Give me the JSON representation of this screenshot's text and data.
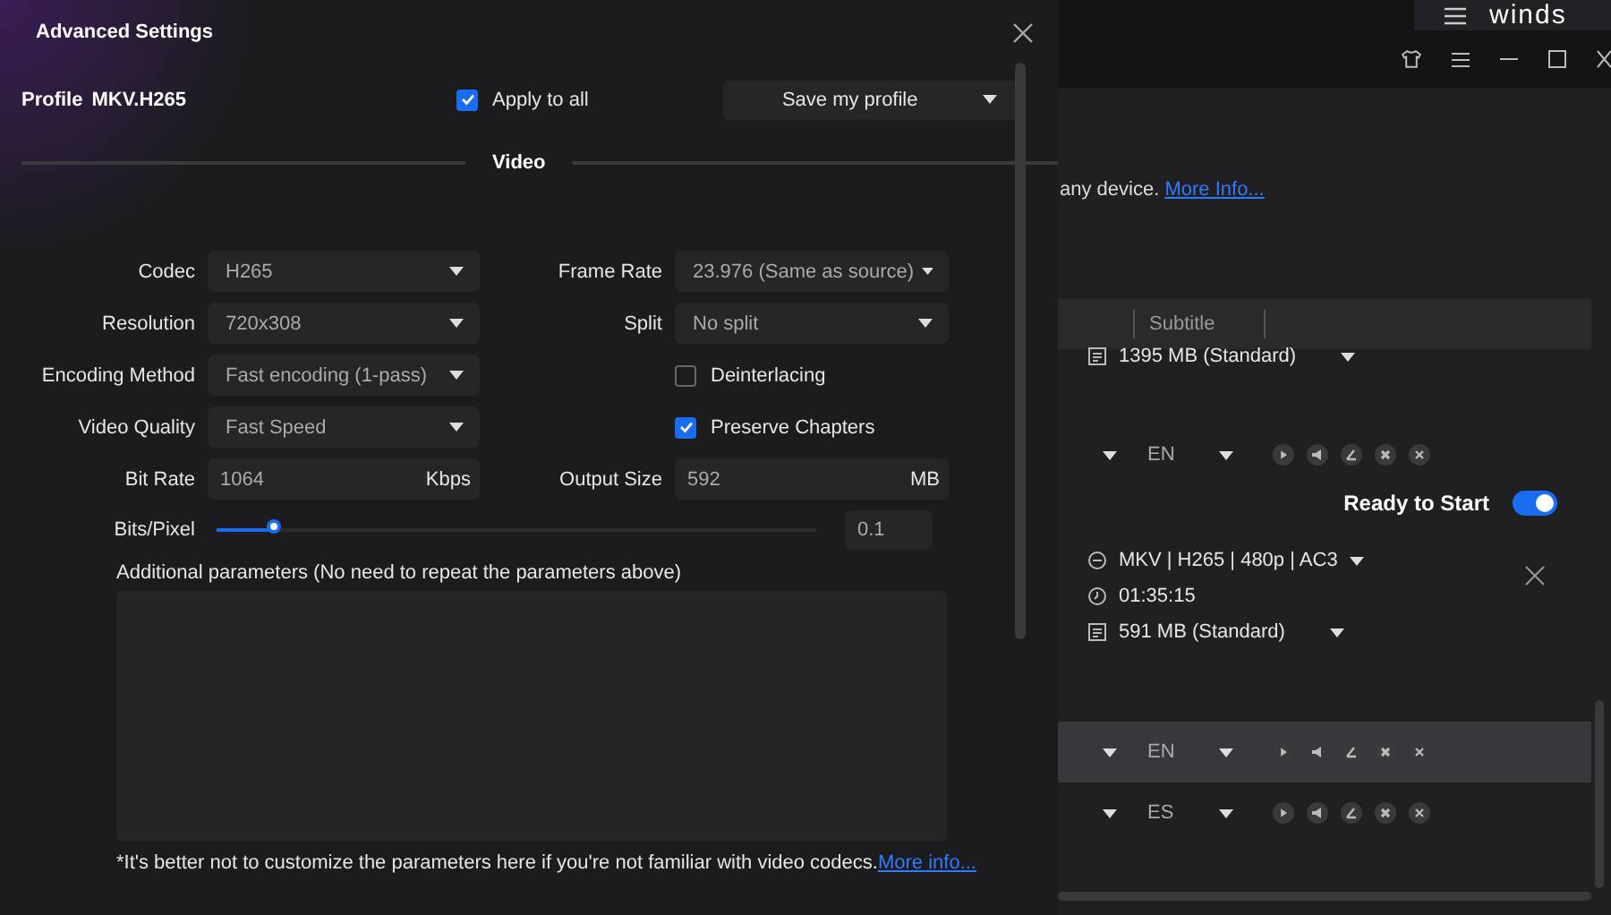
{
  "dialog": {
    "title": "Advanced Settings",
    "profile_label": "Profile",
    "profile_value": "MKV.H265",
    "apply_to_all": {
      "label": "Apply to all",
      "checked": true
    },
    "save_profile": "Save my profile",
    "section": "Video",
    "left_fields": [
      {
        "kind": "select",
        "label": "Codec",
        "value": "H265"
      },
      {
        "kind": "select",
        "label": "Resolution",
        "value": "720x308"
      },
      {
        "kind": "select",
        "label": "Encoding Method",
        "value": "Fast encoding (1-pass)"
      },
      {
        "kind": "select",
        "label": "Video Quality",
        "value": "Fast Speed"
      },
      {
        "kind": "input",
        "label": "Bit Rate",
        "value": "1064",
        "unit": "Kbps"
      }
    ],
    "right_fields": [
      {
        "kind": "select",
        "label": "Frame Rate",
        "value": "23.976 (Same as source)"
      },
      {
        "kind": "select",
        "label": "Split",
        "value": "No split"
      },
      {
        "kind": "checkbox",
        "label": "Deinterlacing",
        "checked": false
      },
      {
        "kind": "checkbox",
        "label": "Preserve Chapters",
        "checked": true
      },
      {
        "kind": "input",
        "label": "Output Size",
        "value": "592",
        "unit": "MB"
      }
    ],
    "bits_pixel": {
      "label": "Bits/Pixel",
      "level": 0.1,
      "value": "0.1"
    },
    "additional_label": "Additional parameters (No need to repeat the parameters above)",
    "note": "*It's better not to customize the parameters here if you're not familiar with video codecs.",
    "note_link": "More info..."
  },
  "background_app": {
    "logo": "winds",
    "description": "any device.",
    "more_info": "More Info...",
    "column_header": "Subtitle",
    "first_size": "1395 MB (Standard)",
    "first_track": {
      "language": "EN",
      "highlighted": false
    },
    "status": {
      "label": "Ready to Start",
      "on": true
    },
    "format": "MKV | H265 | 480p | AC3",
    "duration": "01:35:15",
    "size": "591 MB (Standard)",
    "tracks": [
      {
        "language": "EN",
        "highlighted": true
      },
      {
        "language": "ES",
        "highlighted": false
      }
    ]
  }
}
